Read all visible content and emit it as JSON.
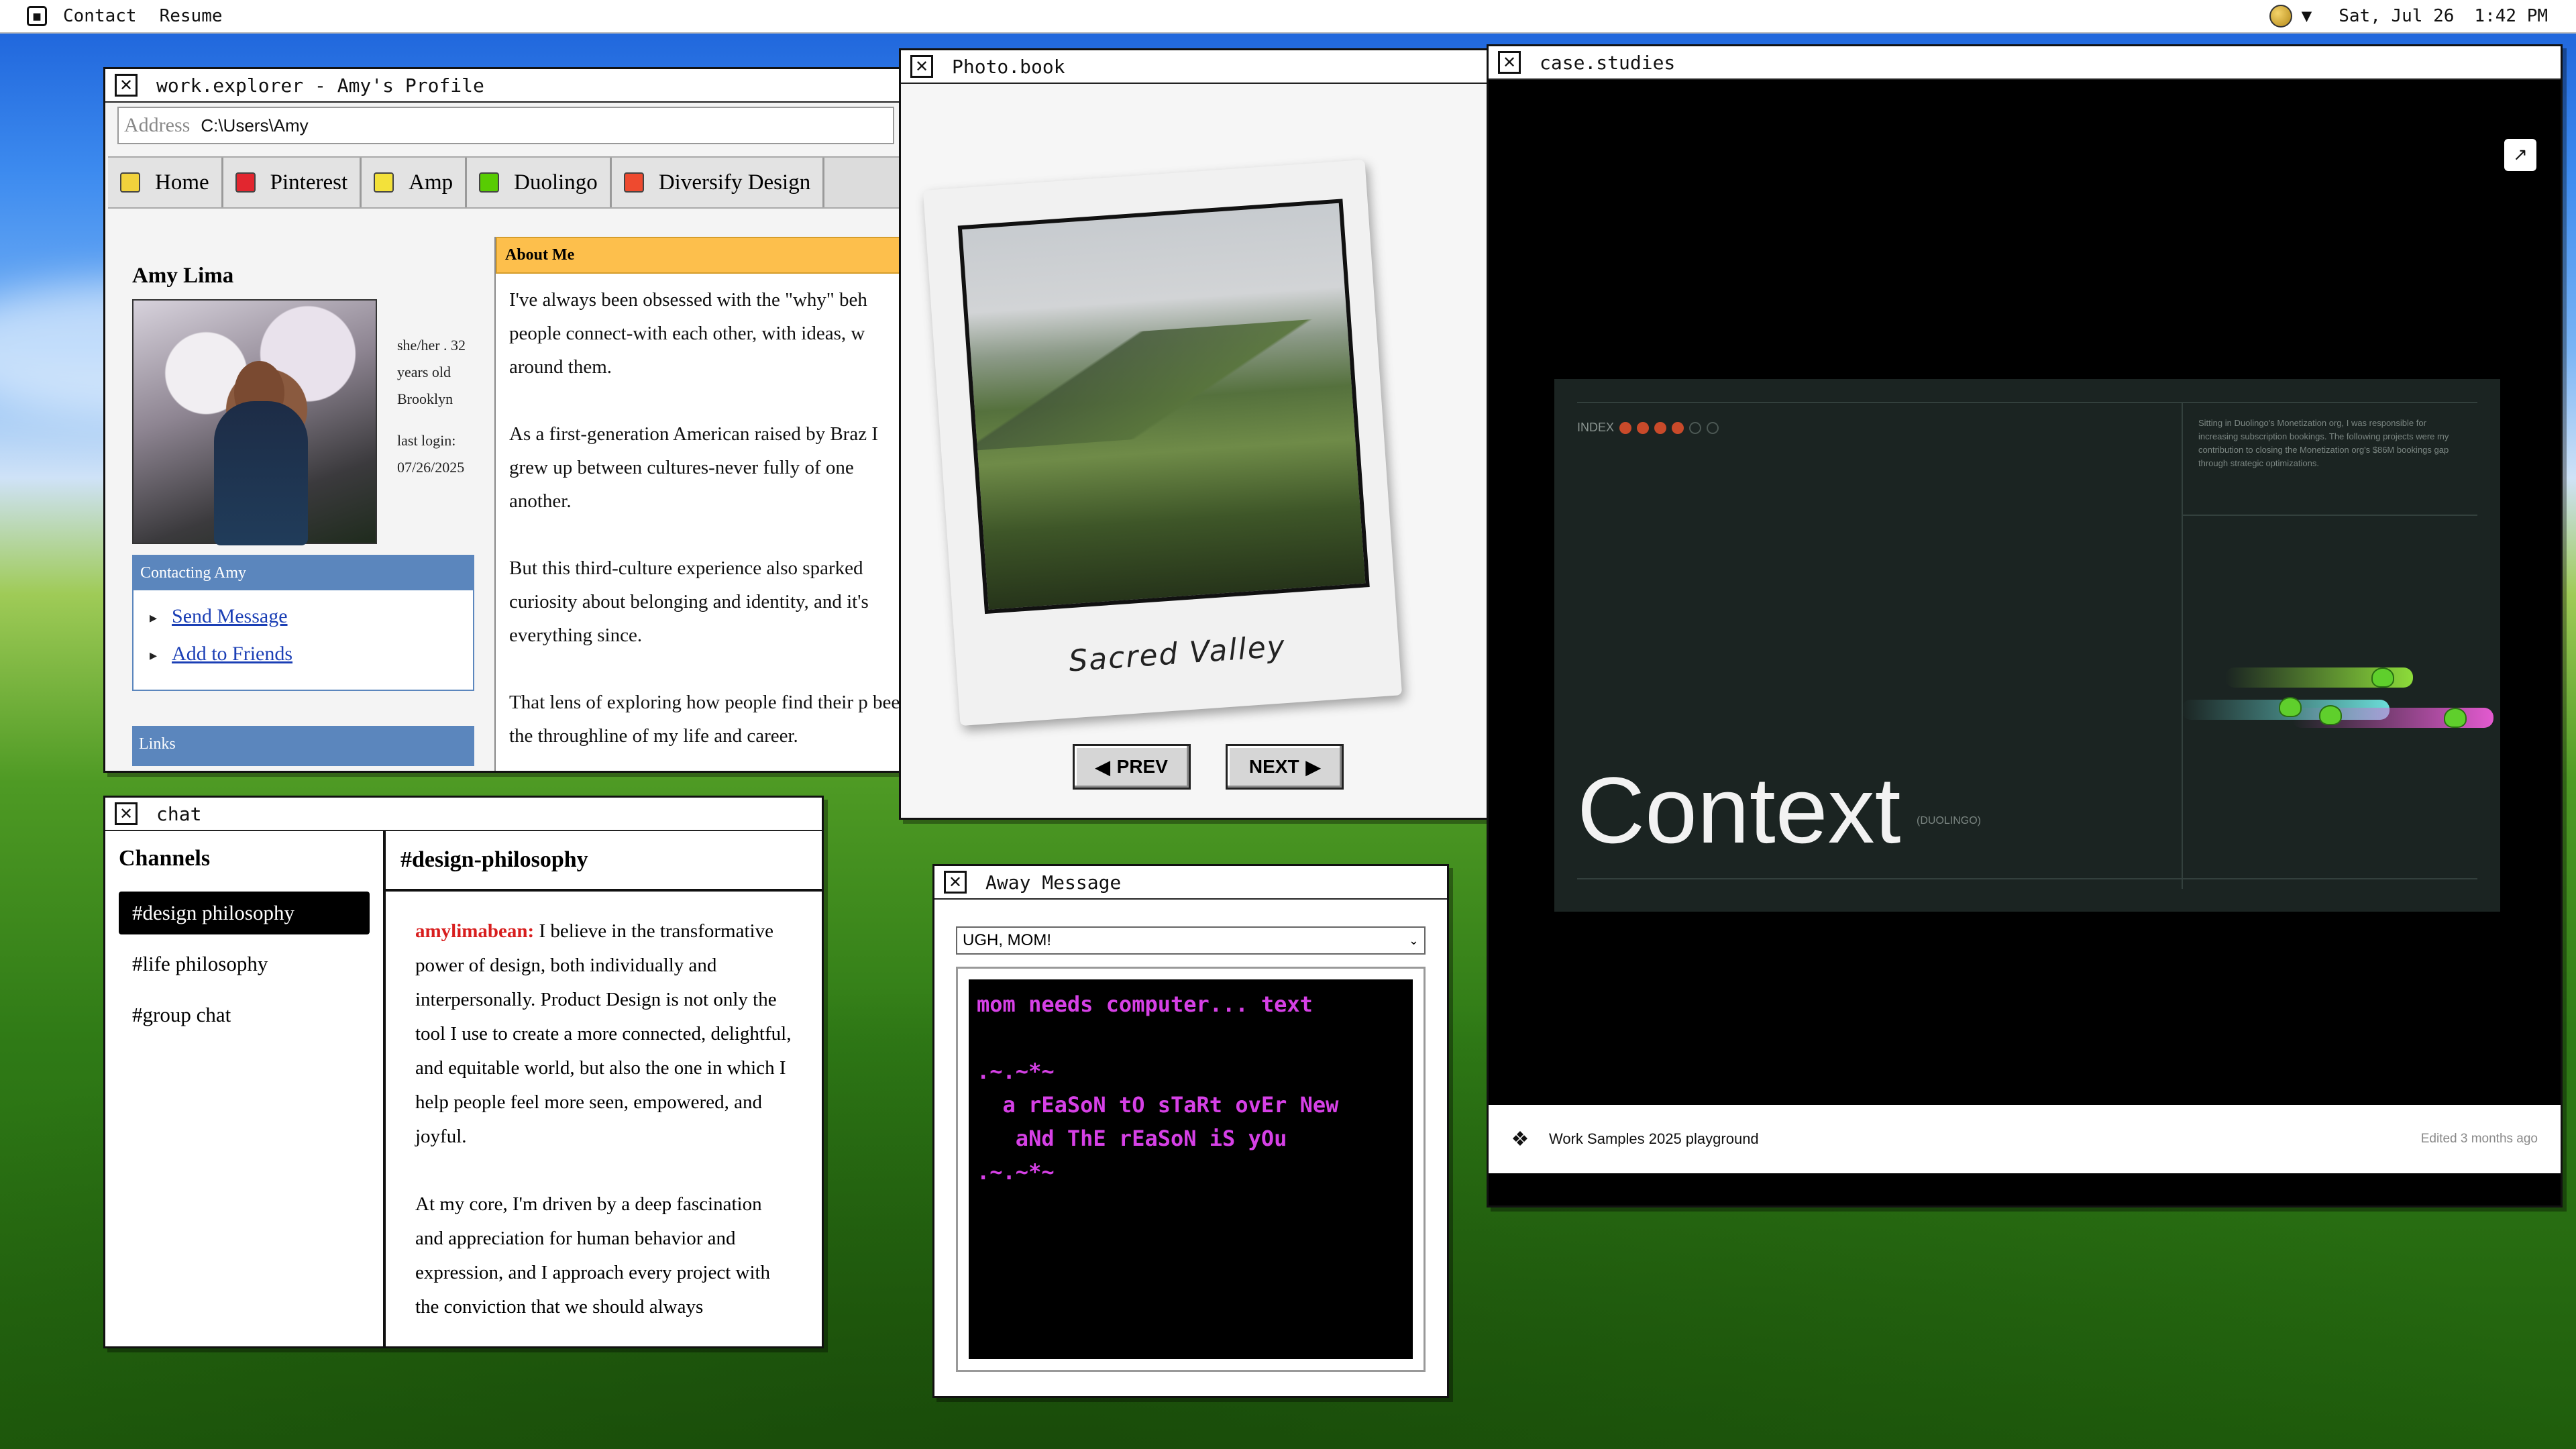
{
  "menubar": {
    "items": [
      "Contact",
      "Resume"
    ],
    "date": "Sat, Jul 26",
    "time": "1:42 PM"
  },
  "explorer": {
    "title": "work.explorer - Amy's Profile",
    "address_label": "Address",
    "address_value": "C:\\Users\\Amy",
    "bookmarks": [
      {
        "label": "Home",
        "color": "#f1d23c"
      },
      {
        "label": "Pinterest",
        "color": "#e2262f"
      },
      {
        "label": "Amp",
        "color": "#f3e13a"
      },
      {
        "label": "Duolingo",
        "color": "#58cc02"
      },
      {
        "label": "Diversify Design",
        "color": "#ee4a2f"
      }
    ],
    "name": "Amy Lima",
    "meta": [
      "she/her . 32",
      "years old",
      "Brooklyn"
    ],
    "last_login_label": "last login:",
    "last_login_value": "07/26/2025",
    "contact_header": "Contacting Amy",
    "contact_links": [
      "Send Message",
      "Add to Friends"
    ],
    "links_header": "Links",
    "about_header": "About Me",
    "about_paragraphs": [
      "I've always been obsessed with the \"why\" beh people connect-with each other, with ideas, w around them.",
      "As a first-generation American raised by Braz I grew up between cultures-never fully of one another.",
      "But this third-culture experience also sparked curiosity about belonging and identity, and it's everything since.",
      "That lens of exploring how people find their p been the throughline of my life and career."
    ]
  },
  "chat": {
    "title": "chat",
    "channels_title": "Channels",
    "channels": [
      "#design philosophy",
      "#life philosophy",
      "#group chat"
    ],
    "active_channel": "#design-philosophy",
    "user": "amylimabean:",
    "message_1": "I believe in the transformative power of design, both individually and interpersonally. Product Design is not only the tool I use to create a more connected, delightful, and equitable world, but also the one in which I help people feel more seen, empowered, and joyful.",
    "message_2": "At my core, I'm driven by a deep fascination and appreciation for human behavior and expression, and I approach every project with the conviction that we should always"
  },
  "photobook": {
    "title": "Photo.book",
    "caption": "Sacred Valley",
    "prev_label": "PREV",
    "next_label": "NEXT"
  },
  "case": {
    "title": "case.studies",
    "index_label": "INDEX",
    "note": "Sitting in Duolingo's Monetization org, I was responsible for increasing subscription bookings. The following projects were my contribution to closing the Monetization org's $86M bookings gap through strategic optimizations.",
    "heading": "Context",
    "tag": "(DUOLINGO)",
    "footer_title": "Work Samples 2025 playground",
    "footer_edited": "Edited 3 months ago"
  },
  "away": {
    "title": "Away Message",
    "selected": "UGH, MOM!",
    "lines": [
      "mom needs computer... text",
      "",
      ".~.~*~",
      "  a rEaSoN tO sTaRt ovEr New",
      "   aNd ThE rEaSoN iS yOu",
      ".~.~*~"
    ]
  }
}
